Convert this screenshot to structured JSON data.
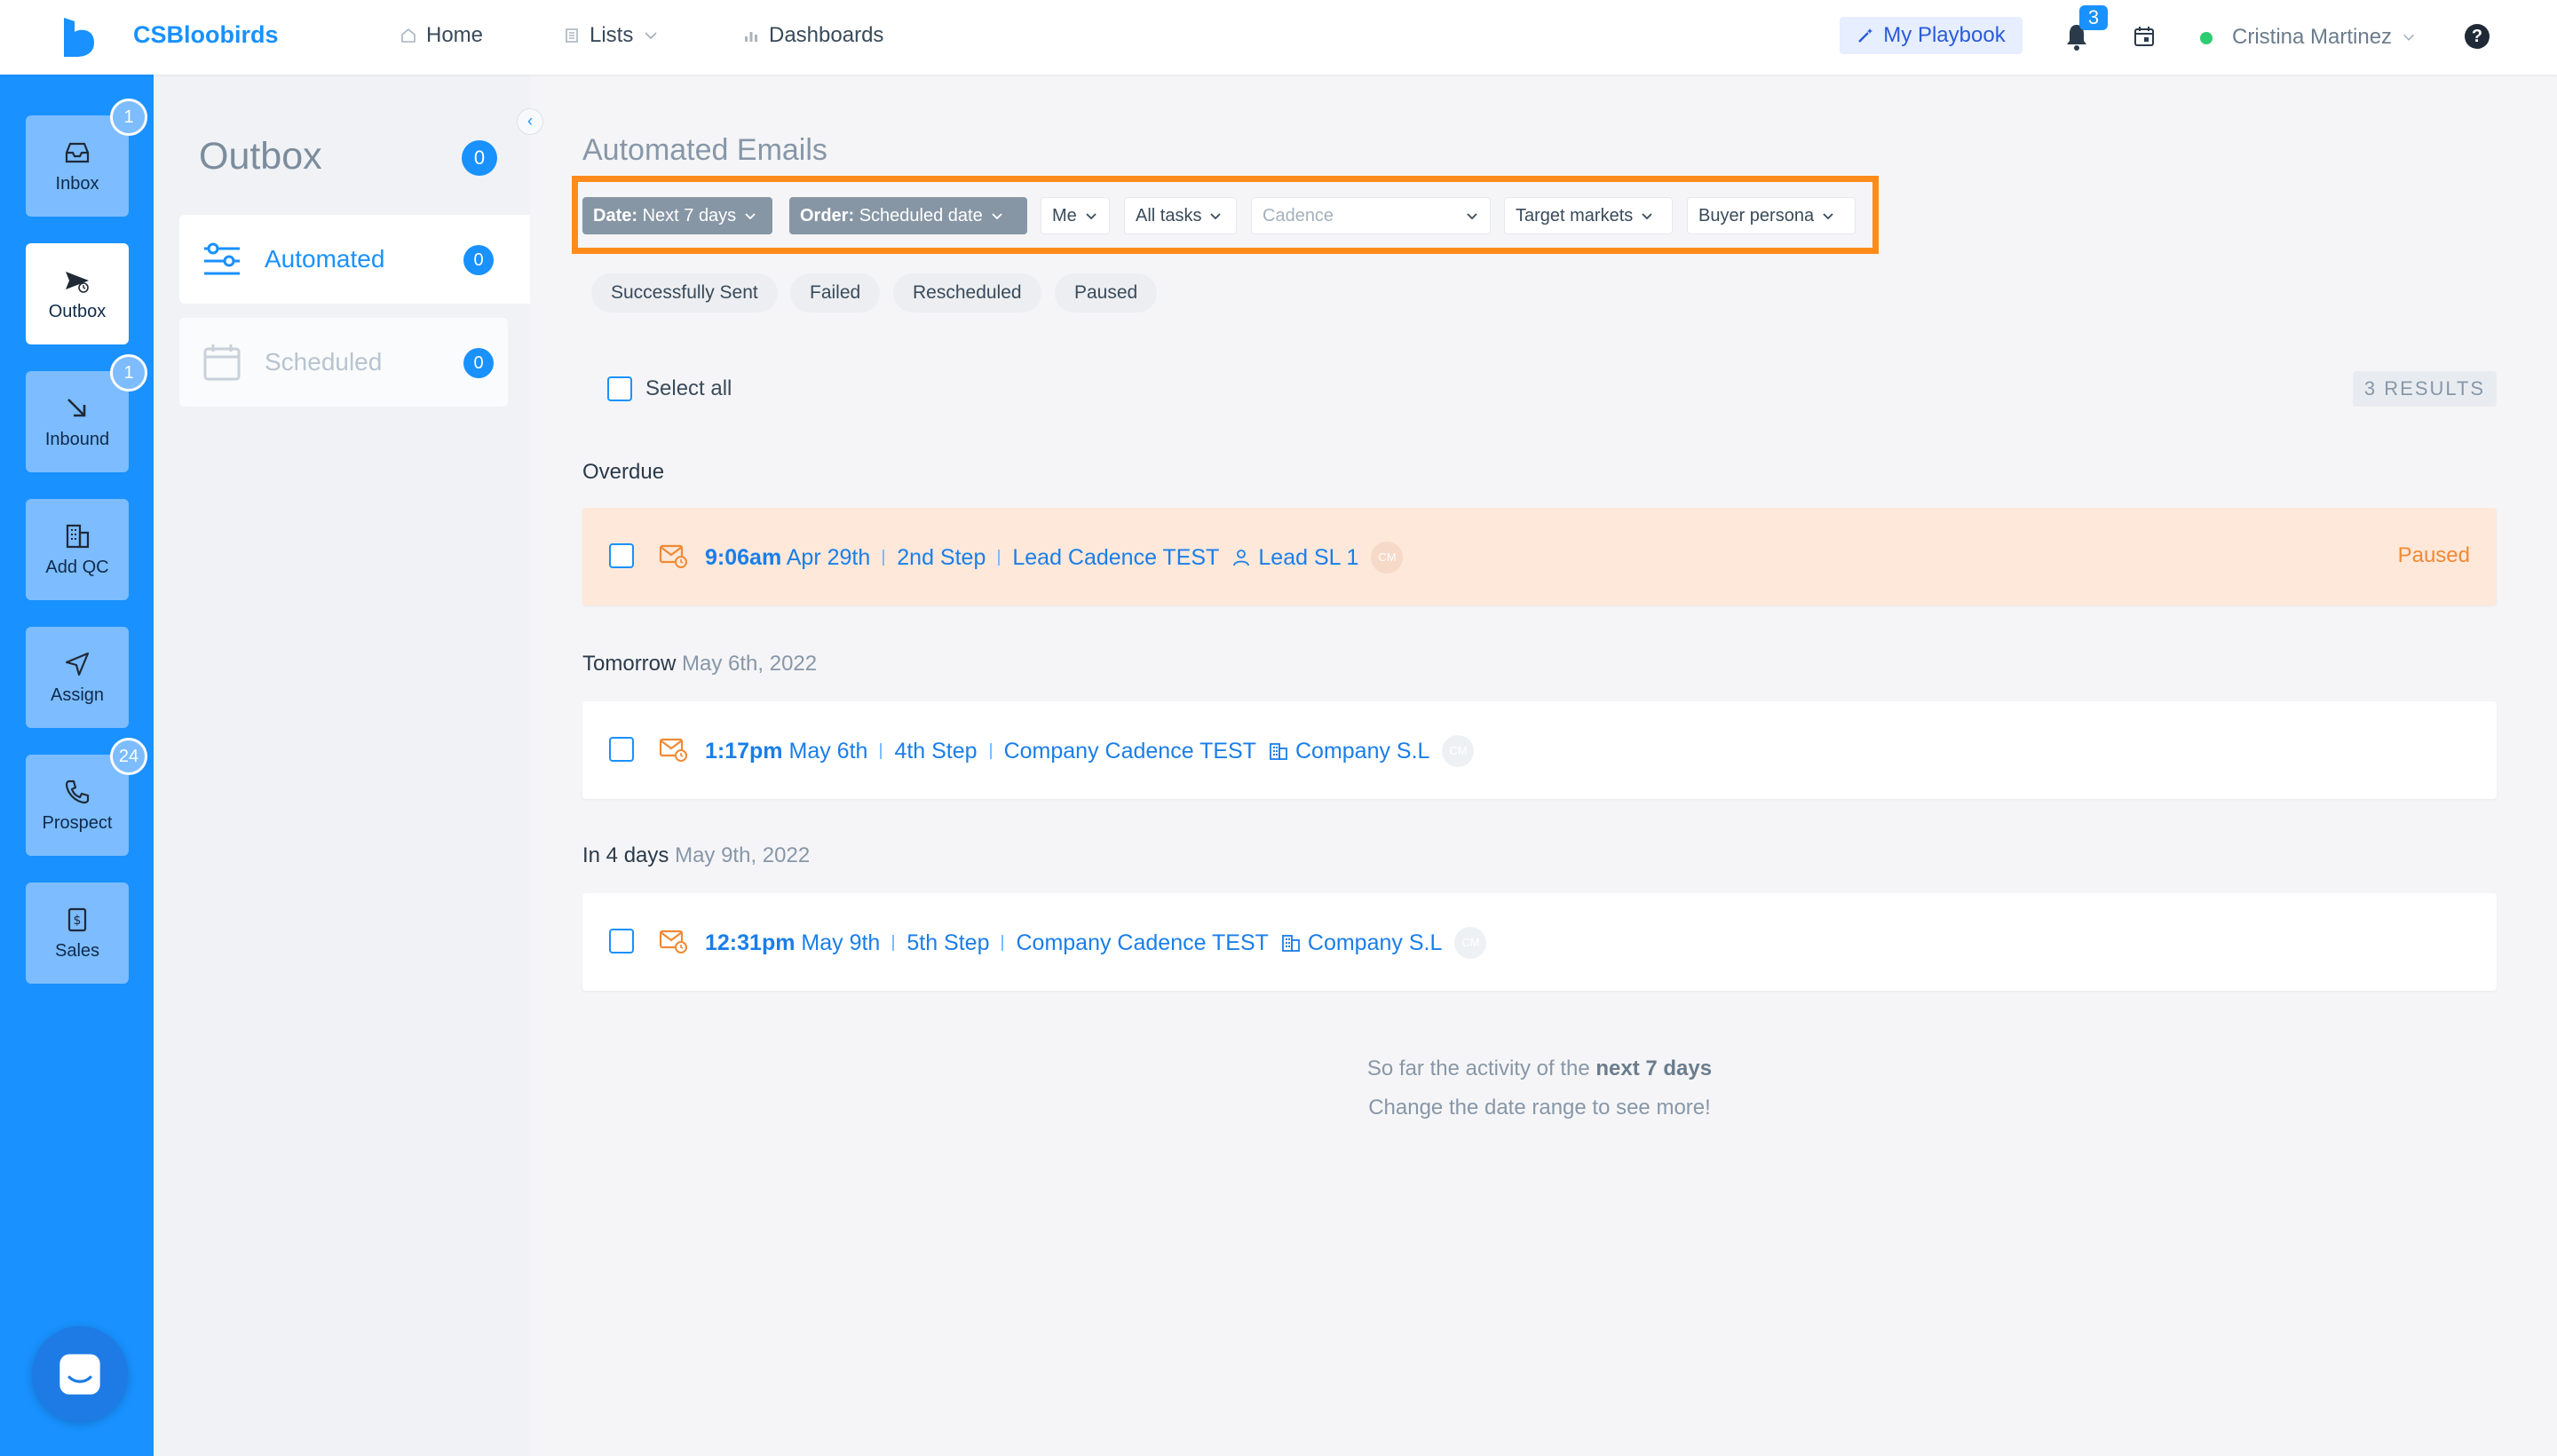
{
  "app": {
    "brand": "CSBloobirds",
    "nav": [
      {
        "label": "Home",
        "icon": "home-icon"
      },
      {
        "label": "Lists",
        "icon": "list-icon"
      },
      {
        "label": "Dashboards",
        "icon": "bar-chart-icon"
      }
    ],
    "playbook_label": "My Playbook",
    "notifications_count": "3",
    "user_name": "Cristina Martinez",
    "status_color": "#2ecc71",
    "accent": "#1991ff",
    "highlight": "#ff8c1a"
  },
  "leftbar": {
    "items": [
      {
        "label": "Inbox",
        "icon": "inbox-icon",
        "badge": "1"
      },
      {
        "label": "Outbox",
        "icon": "send-icon",
        "badge": ""
      },
      {
        "label": "Inbound",
        "icon": "arrow-down-right-icon",
        "badge": "1"
      },
      {
        "label": "Add QC",
        "icon": "building-icon",
        "badge": ""
      },
      {
        "label": "Assign",
        "icon": "navigate-icon",
        "badge": ""
      },
      {
        "label": "Prospect",
        "icon": "phone-icon",
        "badge": "24"
      },
      {
        "label": "Sales",
        "icon": "dollar-icon",
        "badge": ""
      }
    ],
    "active": "Outbox"
  },
  "subbar": {
    "title": "Outbox",
    "title_count": "0",
    "items": [
      {
        "label": "Automated",
        "count": "0",
        "icon": "sliders-icon"
      },
      {
        "label": "Scheduled",
        "count": "0",
        "icon": "calendar-icon"
      }
    ]
  },
  "main": {
    "title": "Automated Emails",
    "filters": {
      "date_key": "Date:",
      "date_value": "Next 7 days",
      "order_key": "Order:",
      "order_value": "Scheduled date",
      "owner": "Me",
      "tasks": "All tasks",
      "cadence_placeholder": "Cadence",
      "target_markets": "Target markets",
      "buyer_persona": "Buyer persona"
    },
    "status_filters": [
      "Successfully Sent",
      "Failed",
      "Rescheduled",
      "Paused"
    ],
    "select_all": "Select all",
    "results": "3 RESULTS",
    "groups": [
      {
        "label": "Overdue",
        "date": "",
        "rows": [
          {
            "time": "9:06am",
            "date": "Apr 29th",
            "step": "2nd Step",
            "cadence": "Lead Cadence TEST",
            "target": "Lead SL 1",
            "target_icon": "person-icon",
            "avatar": "CM",
            "status": "Paused"
          }
        ]
      },
      {
        "label": "Tomorrow",
        "date": "May 6th, 2022",
        "rows": [
          {
            "time": "1:17pm",
            "date": "May 6th",
            "step": "4th Step",
            "cadence": "Company Cadence TEST",
            "target": "Company S.L",
            "target_icon": "building-icon",
            "avatar": "CM",
            "status": ""
          }
        ]
      },
      {
        "label": "In 4 days",
        "date": "May 9th, 2022",
        "rows": [
          {
            "time": "12:31pm",
            "date": "May 9th",
            "step": "5th Step",
            "cadence": "Company Cadence TEST",
            "target": "Company S.L",
            "target_icon": "building-icon",
            "avatar": "CM",
            "status": ""
          }
        ]
      }
    ],
    "footer_line1_prefix": "So far the activity of the ",
    "footer_line1_bold": "next 7 days",
    "footer_line2": "Change the date range to see more!"
  }
}
